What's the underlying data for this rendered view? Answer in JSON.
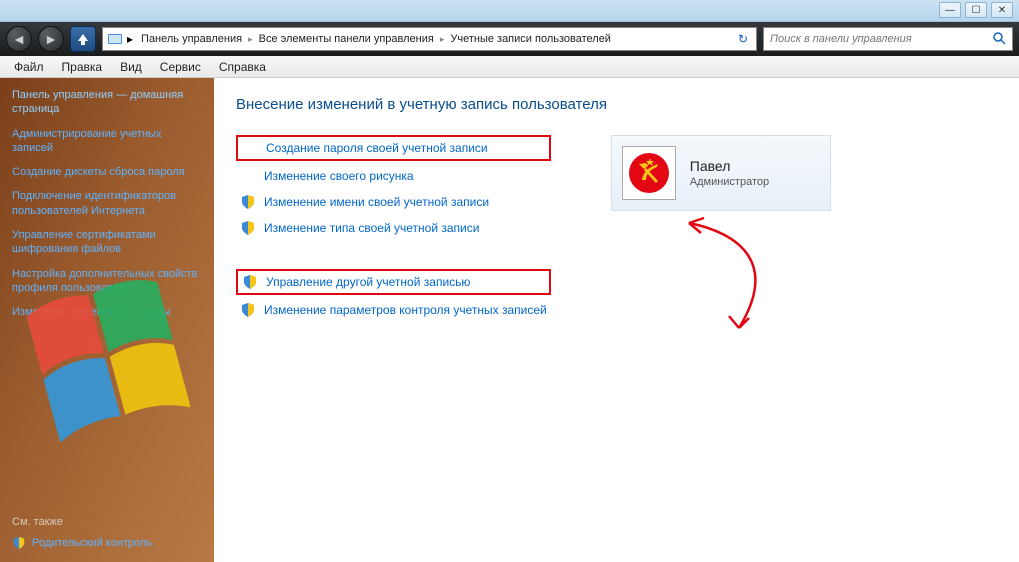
{
  "window_controls": {
    "min": "—",
    "max": "☐",
    "close": "✕"
  },
  "nav": {
    "back": "◄",
    "forward": "►",
    "up": "▲",
    "breadcrumb": [
      "Панель управления",
      "Все элементы панели управления",
      "Учетные записи пользователей"
    ],
    "refresh": "↻",
    "search_placeholder": "Поиск в панели управления"
  },
  "menubar": [
    "Файл",
    "Правка",
    "Вид",
    "Сервис",
    "Справка"
  ],
  "help": "?",
  "sidebar": {
    "home": "Панель управления — домашняя страница",
    "links": [
      "Администрирование учетных записей",
      "Создание дискеты сброса пароля",
      "Подключение идентификаторов пользователей Интернета",
      "Управление сертификатами шифрования файлов",
      "Настройка дополнительных свойств профиля пользователя",
      "Изменение переменных среды"
    ],
    "see_also": "См. также",
    "parental": "Родительский контроль"
  },
  "content": {
    "heading": "Внесение изменений в учетную запись пользователя",
    "tasks_group1": [
      {
        "label": "Создание пароля своей учетной записи",
        "shield": false,
        "boxed": true
      },
      {
        "label": "Изменение своего рисунка",
        "shield": false,
        "boxed": false
      },
      {
        "label": "Изменение имени своей учетной записи",
        "shield": true,
        "boxed": false
      },
      {
        "label": "Изменение типа своей учетной записи",
        "shield": true,
        "boxed": false
      }
    ],
    "tasks_group2": [
      {
        "label": "Управление другой учетной записью",
        "shield": true,
        "boxed": true
      },
      {
        "label": "Изменение параметров контроля учетных записей",
        "shield": true,
        "boxed": false
      }
    ],
    "user": {
      "name": "Павел",
      "role": "Администратор"
    }
  }
}
